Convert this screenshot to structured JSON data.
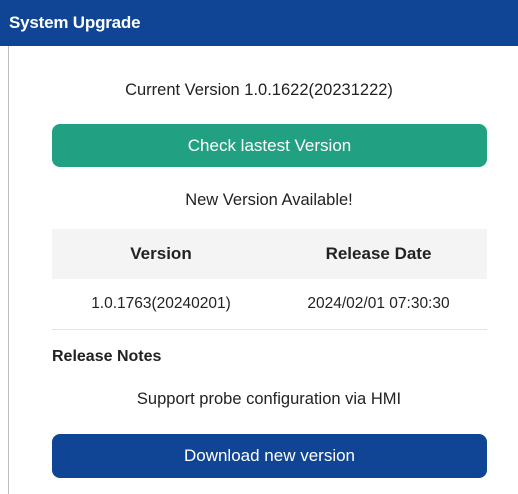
{
  "dialog": {
    "title": "System Upgrade",
    "current_version_text": "Current Version 1.0.1622(20231222)",
    "check_button_label": "Check lastest Version",
    "new_version_text": "New Version Available!",
    "table": {
      "headers": [
        "Version",
        "Release Date"
      ],
      "rows": [
        [
          "1.0.1763(20240201)",
          "2024/02/01 07:30:30"
        ]
      ]
    },
    "release_notes_label": "Release Notes",
    "release_notes_text": "Support probe configuration via HMI",
    "download_button_label": "Download new version"
  },
  "colors": {
    "title_bar": "#0f4594",
    "check_button": "#22a082",
    "download_button": "#0f4594"
  }
}
